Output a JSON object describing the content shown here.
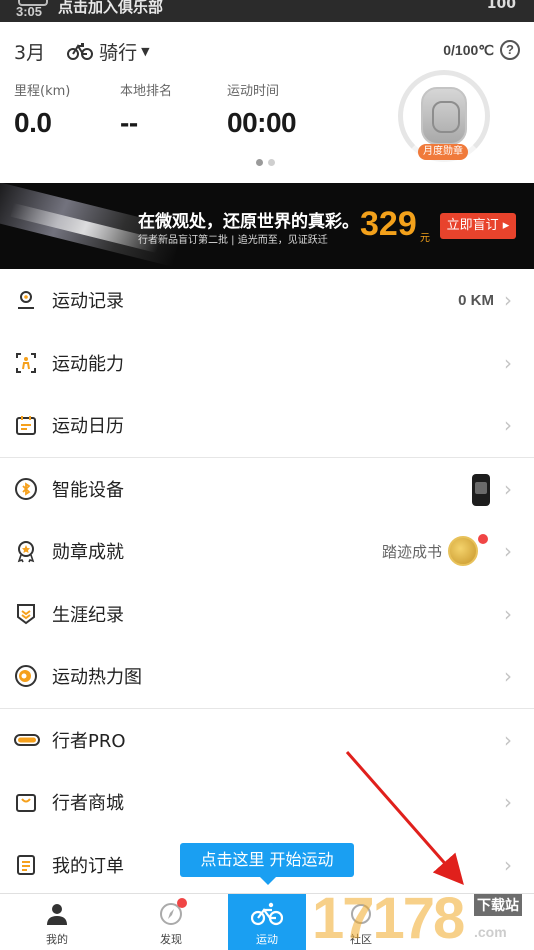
{
  "status_bar": {
    "time": "3:05",
    "club_text": "点击加入俱乐部",
    "right_text": "100"
  },
  "header": {
    "month": "3月",
    "sport": "骑行",
    "temperature": "0/100℃",
    "help_glyph": "?",
    "stats": [
      {
        "label": "里程(km)",
        "value": "0.0"
      },
      {
        "label": "本地排名",
        "value": "--"
      },
      {
        "label": "运动时间",
        "value": "00:00"
      }
    ],
    "medal_badge": "月度勋章",
    "carousel_pages": 2,
    "carousel_active": 1
  },
  "banner": {
    "slogan": "在微观处，还原世界的真彩。",
    "subtext": "行者新品盲订第二批 | 追光而至，见证跃迁",
    "price": "329",
    "currency": "元",
    "cta": "立即盲订"
  },
  "menu": {
    "groups": [
      [
        {
          "label": "运动记录",
          "icon": "location-pin-icon",
          "meta": "0 KM"
        },
        {
          "label": "运动能力",
          "icon": "person-focus-icon",
          "meta": ""
        },
        {
          "label": "运动日历",
          "icon": "calendar-icon",
          "meta": ""
        }
      ],
      [
        {
          "label": "智能设备",
          "icon": "bluetooth-icon",
          "meta": ""
        },
        {
          "label": "勋章成就",
          "icon": "medal-icon",
          "meta": "踏迹成书"
        },
        {
          "label": "生涯纪录",
          "icon": "rank-badge-icon",
          "meta": ""
        },
        {
          "label": "运动热力图",
          "icon": "heatmap-icon",
          "meta": ""
        }
      ],
      [
        {
          "label": "行者PRO",
          "icon": "pro-icon",
          "meta": ""
        },
        {
          "label": "行者商城",
          "icon": "shop-bag-icon",
          "meta": ""
        },
        {
          "label": "我的订单",
          "icon": "order-list-icon",
          "meta": ""
        }
      ]
    ]
  },
  "tooltip": "点击这里 开始运动",
  "tabs": [
    {
      "label": "我的",
      "icon": "person-icon"
    },
    {
      "label": "发现",
      "icon": "compass-icon"
    },
    {
      "label": "运动",
      "icon": "bike-icon"
    },
    {
      "label": "社区",
      "icon": "community-icon"
    }
  ],
  "watermark": {
    "main": "17178",
    "tag": "下载站",
    "domain": ".com"
  },
  "colors": {
    "accent_blue": "#1a9ff2",
    "accent_orange": "#f3a11b",
    "badge_red": "#f04545",
    "medal_orange": "#f07a3b",
    "icon_orange": "#f5a01c"
  }
}
